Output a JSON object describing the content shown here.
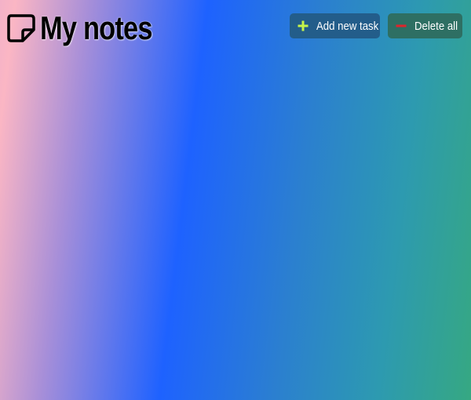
{
  "header": {
    "title": "My notes",
    "title_icon": "sticky-note-icon"
  },
  "toolbar": {
    "add_label": "Add new task",
    "add_icon": "plus-icon",
    "delete_label": "Delete all",
    "delete_icon": "minus-icon"
  },
  "colors": {
    "add_button_bg": "#235d8a",
    "delete_button_bg": "#2e6f63",
    "plus_icon": "#c7f54a",
    "minus_icon": "#e0242b",
    "gradient_left": "#fbb6c4",
    "gradient_mid": "#1e62ff",
    "gradient_right": "#36a882"
  }
}
